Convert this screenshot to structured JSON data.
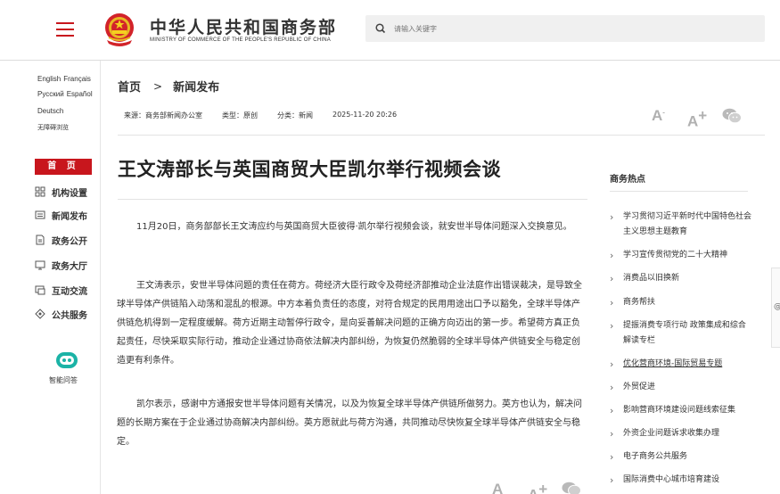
{
  "header": {
    "title": "中华人民共和国商务部",
    "subtitle": "MINISTRY OF COMMERCE OF THE PEOPLE'S REPUBLIC OF CHINA",
    "search_placeholder": "请输入关键字"
  },
  "languages": [
    "English",
    "Français",
    "Русский",
    "Español",
    "Deutsch"
  ],
  "barrier_free": "无障碍浏览",
  "nav": {
    "home": "首 页",
    "items": [
      {
        "label": "机构设置",
        "icon": "org-chart-icon"
      },
      {
        "label": "新闻发布",
        "icon": "news-icon"
      },
      {
        "label": "政务公开",
        "icon": "document-icon"
      },
      {
        "label": "政务大厅",
        "icon": "monitor-icon"
      },
      {
        "label": "互动交流",
        "icon": "chat-icon"
      },
      {
        "label": "公共服务",
        "icon": "service-icon"
      }
    ],
    "assistant_label": "智能问答"
  },
  "breadcrumb": {
    "home": "首页",
    "separator": ">",
    "current": "新闻发布"
  },
  "meta": {
    "source": "来源：商务部新闻办公室",
    "type": "类型：原创",
    "category": "分类：新闻",
    "datetime": "2025-11-20 20:26"
  },
  "tools": {
    "font_small": "A",
    "font_large": "A",
    "plus": "+"
  },
  "article": {
    "title": "王文涛部长与英国商贸大臣凯尔举行视频会谈",
    "paragraphs": [
      "11月20日，商务部部长王文涛应约与英国商贸大臣彼得·凯尔举行视频会谈，就安世半导体问题深入交换意见。",
      "王文涛表示，安世半导体问题的责任在荷方。荷经济大臣行政令及荷经济部推动企业法庭作出错误裁决，是导致全球半导体产供链陷入动荡和混乱的根源。中方本着负责任的态度，对符合规定的民用用途出口予以豁免，全球半导体产供链危机得到一定程度缓解。荷方近期主动暂停行政令，是向妥善解决问题的正确方向迈出的第一步。希望荷方真正负起责任，尽快采取实际行动，推动企业通过协商依法解决内部纠纷，为恢复仍然脆弱的全球半导体产供链安全与稳定创造更有利条件。",
      "凯尔表示，感谢中方通报安世半导体问题有关情况，以及为恢复全球半导体产供链所做努力。英方也认为，解决问题的长期方案在于企业通过协商解决内部纠纷。英方愿就此与荷方沟通，共同推动尽快恢复全球半导体产供链安全与稳定。"
    ]
  },
  "hot": {
    "title": "商务热点",
    "items": [
      "学习贯彻习近平新时代中国特色社会主义思想主题教育",
      "学习宣传贯彻党的二十大精神",
      "消费品以旧换新",
      "商务帮扶",
      "提振消费专项行动 政策集成和综合解读专栏",
      "优化营商环境-国际贸易专题",
      "外贸促进",
      "影响营商环境建设问题线索征集",
      "外资企业问题诉求收集办理",
      "电子商务公共服务",
      "国际消费中心城市培育建设"
    ]
  },
  "right_edge_glyph": "@",
  "colors": {
    "brand_red": "#c8161d",
    "tool_gray": "#b0b0b0"
  }
}
